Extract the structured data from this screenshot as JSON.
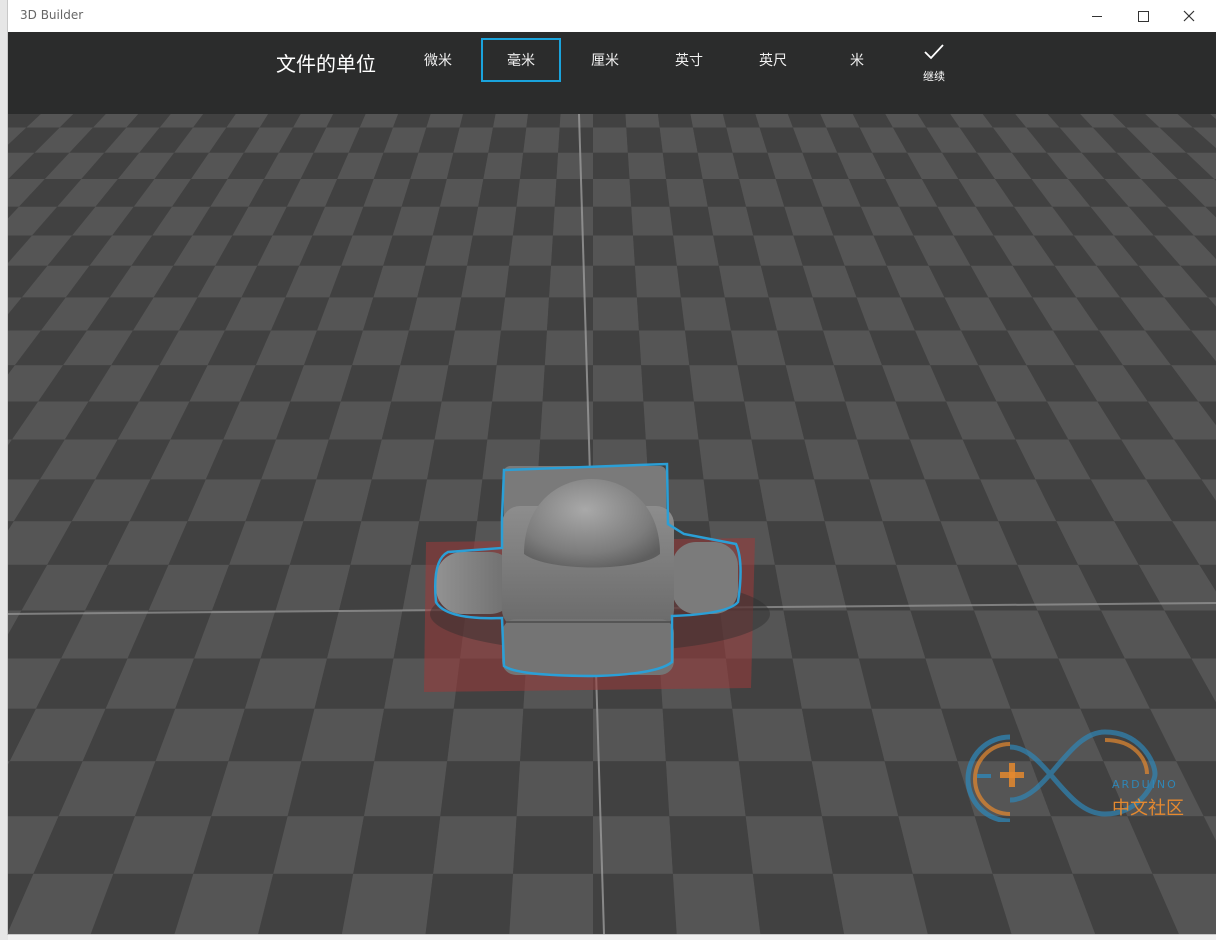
{
  "window": {
    "title": "3D Builder"
  },
  "unit_bar": {
    "title": "文件的单位",
    "options": [
      {
        "label": "微米",
        "selected": false
      },
      {
        "label": "毫米",
        "selected": true
      },
      {
        "label": "厘米",
        "selected": false
      },
      {
        "label": "英寸",
        "selected": false
      },
      {
        "label": "英尺",
        "selected": false
      },
      {
        "label": "米",
        "selected": false
      }
    ],
    "continue_label": "继续",
    "continue_icon": "checkmark-icon"
  },
  "colors": {
    "accent": "#1aa3dc",
    "toolbar_bg": "#2b2c2c",
    "floor_dark": "#414141",
    "floor_light": "#555555",
    "selection_outline": "#2b9fd6",
    "footprint": "#9c3a3a"
  },
  "watermark": {
    "text_en": "ARDUINO",
    "text_cn": "中文社区"
  }
}
